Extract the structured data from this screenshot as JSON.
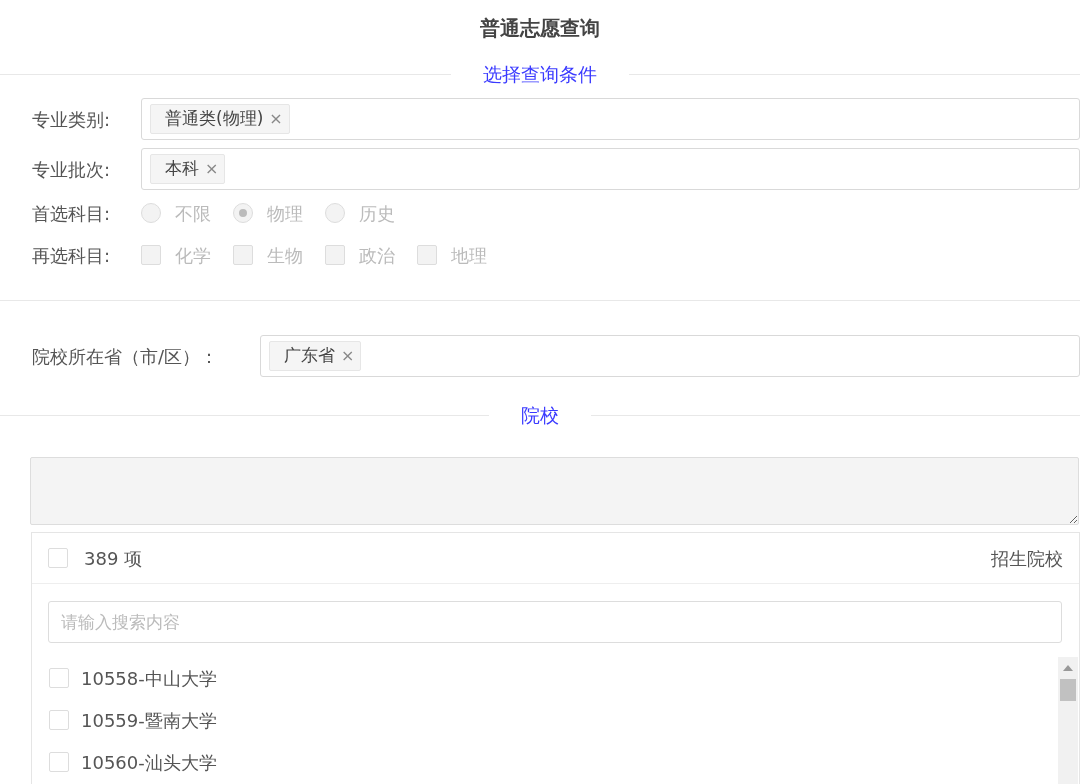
{
  "title": "普通志愿查询",
  "section_1": {
    "heading": "选择查询条件"
  },
  "fields": [
    {
      "label": "专业类别:",
      "tags": [
        {
          "text": "普通类(物理)",
          "remove": "×"
        }
      ]
    },
    {
      "label": "专业批次:",
      "tags": [
        {
          "text": "本科",
          "remove": "×"
        }
      ]
    }
  ],
  "first_subject": {
    "label": "首选科目:",
    "disabled": true,
    "options": [
      {
        "label": "不限",
        "selected": false
      },
      {
        "label": "物理",
        "selected": true
      },
      {
        "label": "历史",
        "selected": false
      }
    ]
  },
  "second_subject": {
    "label": "再选科目:",
    "disabled": true,
    "options": [
      {
        "label": "化学",
        "checked": false
      },
      {
        "label": "生物",
        "checked": false
      },
      {
        "label": "政治",
        "checked": false
      },
      {
        "label": "地理",
        "checked": false
      }
    ]
  },
  "province": {
    "label": "院校所在省（市/区）：",
    "tags": [
      {
        "text": "广东省",
        "remove": "×"
      }
    ]
  },
  "section_2": {
    "heading": "院校"
  },
  "transfer": {
    "select_all_checked": false,
    "count": "389 项",
    "title": "招生院校",
    "search": {
      "placeholder": "请输入搜索内容"
    },
    "items": [
      {
        "label": "10558-中山大学",
        "checked": false
      },
      {
        "label": "10559-暨南大学",
        "checked": false
      },
      {
        "label": "10560-汕头大学",
        "checked": false
      }
    ]
  }
}
